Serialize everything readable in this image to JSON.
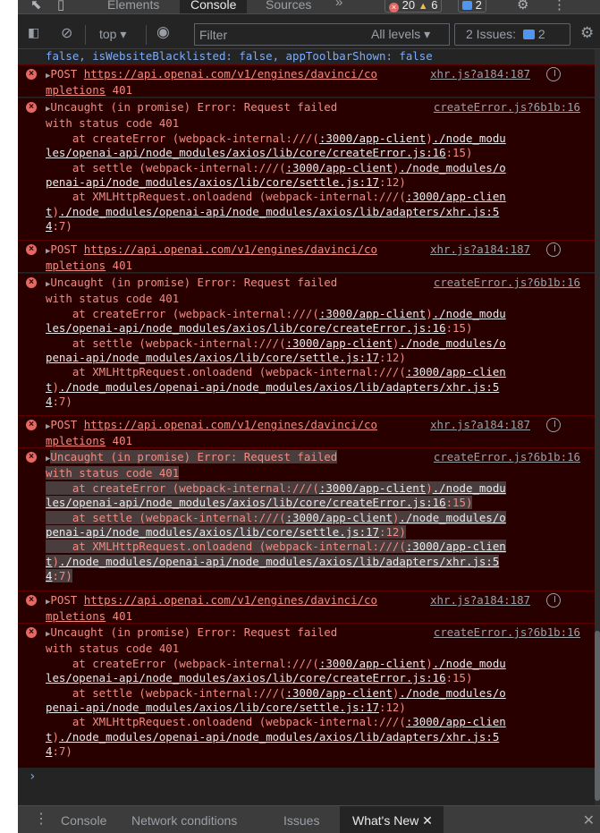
{
  "tabbar": {
    "tabs": [
      "Elements",
      "Console",
      "Sources"
    ],
    "active": "Console",
    "more": "»",
    "error_count": "20",
    "warning_count": "6",
    "message_count": "2"
  },
  "toolbar": {
    "context": "top",
    "filter_placeholder": "Filter",
    "levels": "All levels",
    "issues_label": "2 Issues:",
    "issues_count": "2"
  },
  "console": {
    "first_line": "false, isWebsiteBlacklisted: false, appToolbarShown: false",
    "post": {
      "label": "POST",
      "url_l1": "https://api.openai.com/v1/engines/davinci/co",
      "url_l2": "mpletions",
      "status": "401",
      "source": "xhr.js?a184:187"
    },
    "error": {
      "line1": "Uncaught (in promise) Error: Request failed",
      "line2": "with status code 401",
      "source": "createError.js?6b1b:16",
      "at1_prefix": "    at createError (webpack-internal:///(",
      "at1_host": ":3000/app-client",
      "at1_mid": ")",
      "at1_path1": "./node_modu",
      "at1_path2": "les/openai-api/node_modules/axios/lib/core/createError.js:16",
      "at1_tail": ":15)",
      "at2_prefix": "    at settle (webpack-internal:///(",
      "at2_host": ":3000/app-client",
      "at2_mid": ")",
      "at2_path1": "./node_modules/o",
      "at2_path2": "penai-api/node_modules/axios/lib/core/settle.js:17",
      "at2_tail": ":12)",
      "at3_prefix": "    at XMLHttpRequest.onloadend (webpack-internal:///(",
      "at3_host1": ":3000/app-clien",
      "at3_host2": "t",
      "at3_mid": ")",
      "at3_path1": "./node_modules/openai-api/node_modules/axios/lib/adapters/xhr.js:5",
      "at3_path2": "4",
      "at3_tail": ":7)"
    },
    "prompt": "›"
  },
  "drawer": {
    "tabs": [
      "Console",
      "Network conditions",
      "Issues",
      "What's New"
    ],
    "active": "What's New"
  },
  "colors": {
    "error_bg": "#290000",
    "error_text": "#f28b82",
    "link_blue": "#7cacf8"
  }
}
